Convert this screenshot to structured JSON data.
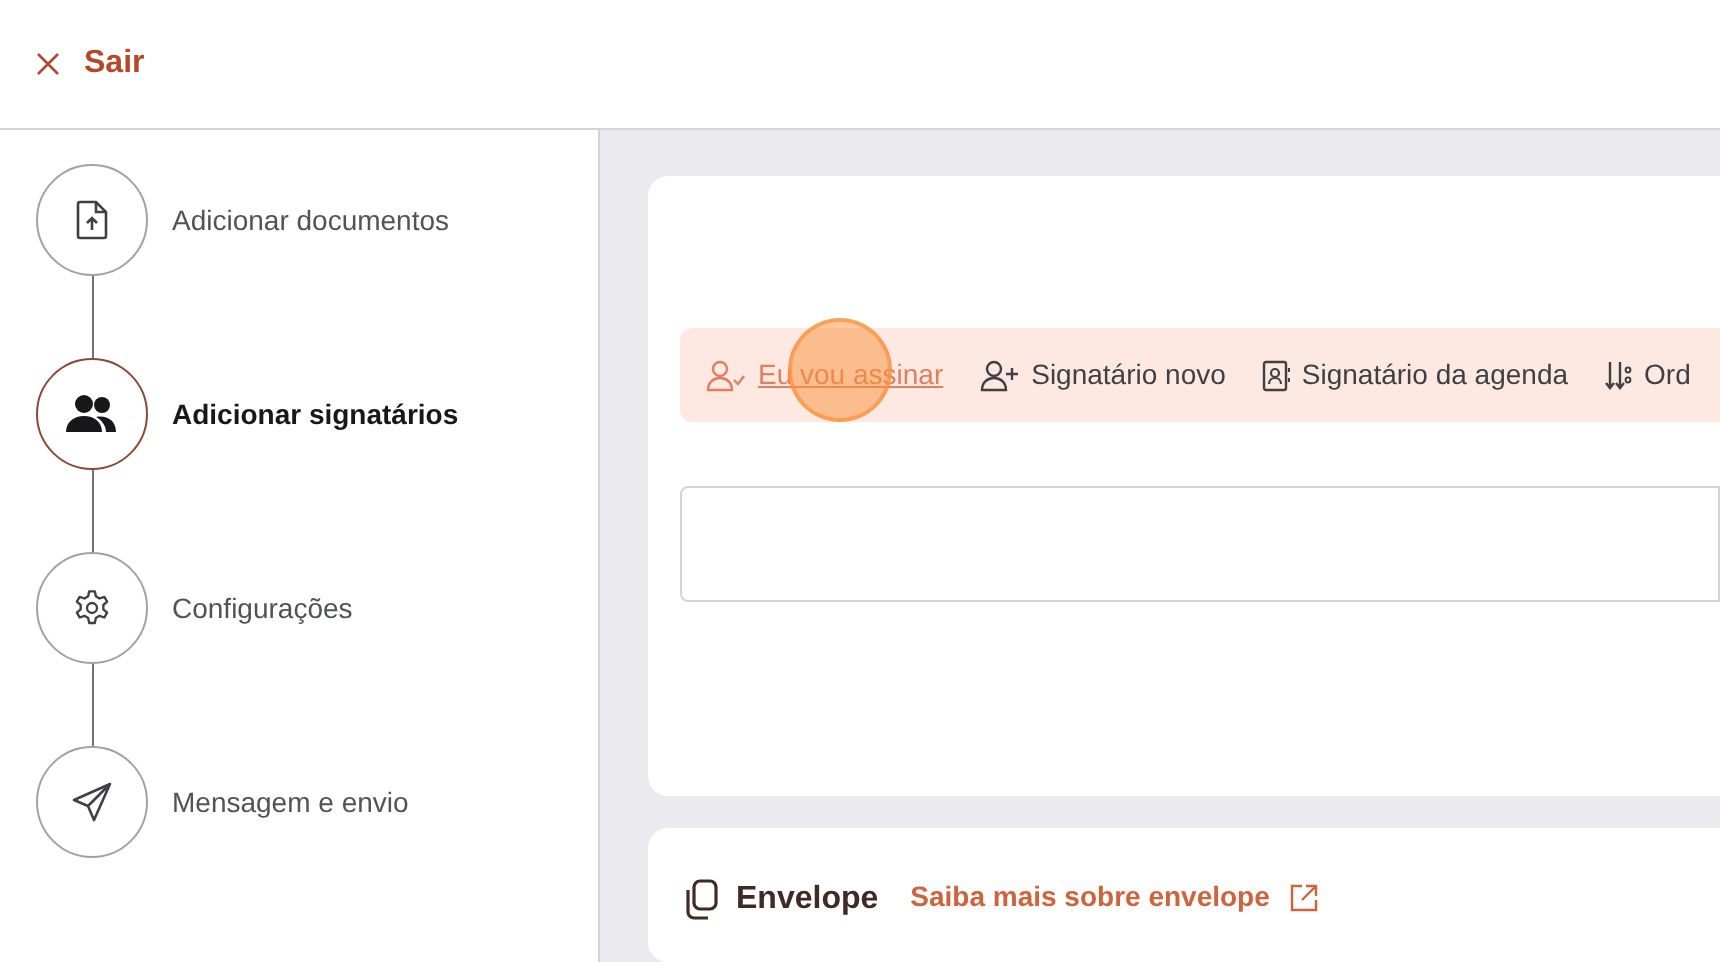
{
  "header": {
    "close_label": "Sair"
  },
  "steps": [
    {
      "label": "Adicionar documentos",
      "selected": false
    },
    {
      "label": "Adicionar signatários",
      "selected": true
    },
    {
      "label": "Configurações",
      "selected": false
    },
    {
      "label": "Mensagem e envio",
      "selected": false
    }
  ],
  "signer_toolbar": [
    {
      "label": "Eu vou assinar",
      "selected": true
    },
    {
      "label": "Signatário novo",
      "selected": false
    },
    {
      "label": "Signatário da agenda",
      "selected": false
    },
    {
      "label": "Ord",
      "selected": false
    }
  ],
  "envelope": {
    "title": "Envelope",
    "link": "Saiba mais sobre envelope"
  }
}
